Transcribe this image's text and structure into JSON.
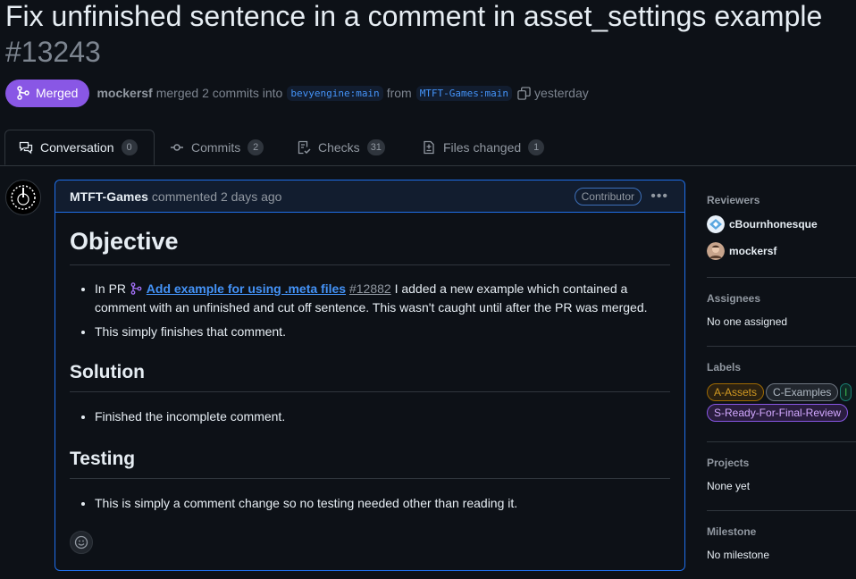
{
  "pr": {
    "title": "Fix unfinished sentence in a comment in asset_settings example",
    "number": "#13243",
    "state_label": "Merged",
    "author": "mockersf",
    "merged_text": "merged 2 commits into",
    "base_branch": "bevyengine:main",
    "from_text": "from",
    "head_branch": "MTFT-Games:main",
    "when": "yesterday"
  },
  "tabs": [
    {
      "label": "Conversation",
      "count": "0"
    },
    {
      "label": "Commits",
      "count": "2"
    },
    {
      "label": "Checks",
      "count": "31"
    },
    {
      "label": "Files changed",
      "count": "1"
    }
  ],
  "comment": {
    "author": "MTFT-Games",
    "meta": "commented 2 days ago",
    "role_badge": "Contributor",
    "heading_objective": "Objective",
    "obj_item1_prefix": "In PR",
    "obj_item1_link": "Add example for using .meta files",
    "obj_item1_num": "#12882",
    "obj_item1_suffix": "I added a new example which contained a comment with an unfinished and cut off sentence. This wasn't caught until after the PR was merged.",
    "obj_item2": "This simply finishes that comment.",
    "heading_solution": "Solution",
    "solution_item1": "Finished the incomplete comment.",
    "heading_testing": "Testing",
    "testing_item1": "This is simply a comment change so no testing needed other than reading it."
  },
  "sidebar": {
    "reviewers_heading": "Reviewers",
    "reviewers": [
      "cBournhonesque",
      "mockersf"
    ],
    "assignees_heading": "Assignees",
    "assignees_value": "No one assigned",
    "labels_heading": "Labels",
    "labels": [
      {
        "name": "A-Assets",
        "color": "#d29922"
      },
      {
        "name": "C-Examples",
        "color": "#8b949e"
      },
      {
        "name": "S-Ready-For-Final-Review",
        "color": "#bc8cff"
      }
    ],
    "projects_heading": "Projects",
    "projects_value": "None yet",
    "milestone_heading": "Milestone",
    "milestone_value": "No milestone"
  },
  "colors": {
    "merged": "#8957e5",
    "link": "#4493f8",
    "background": "#0d1117",
    "highlight_border": "#1f6feb"
  }
}
